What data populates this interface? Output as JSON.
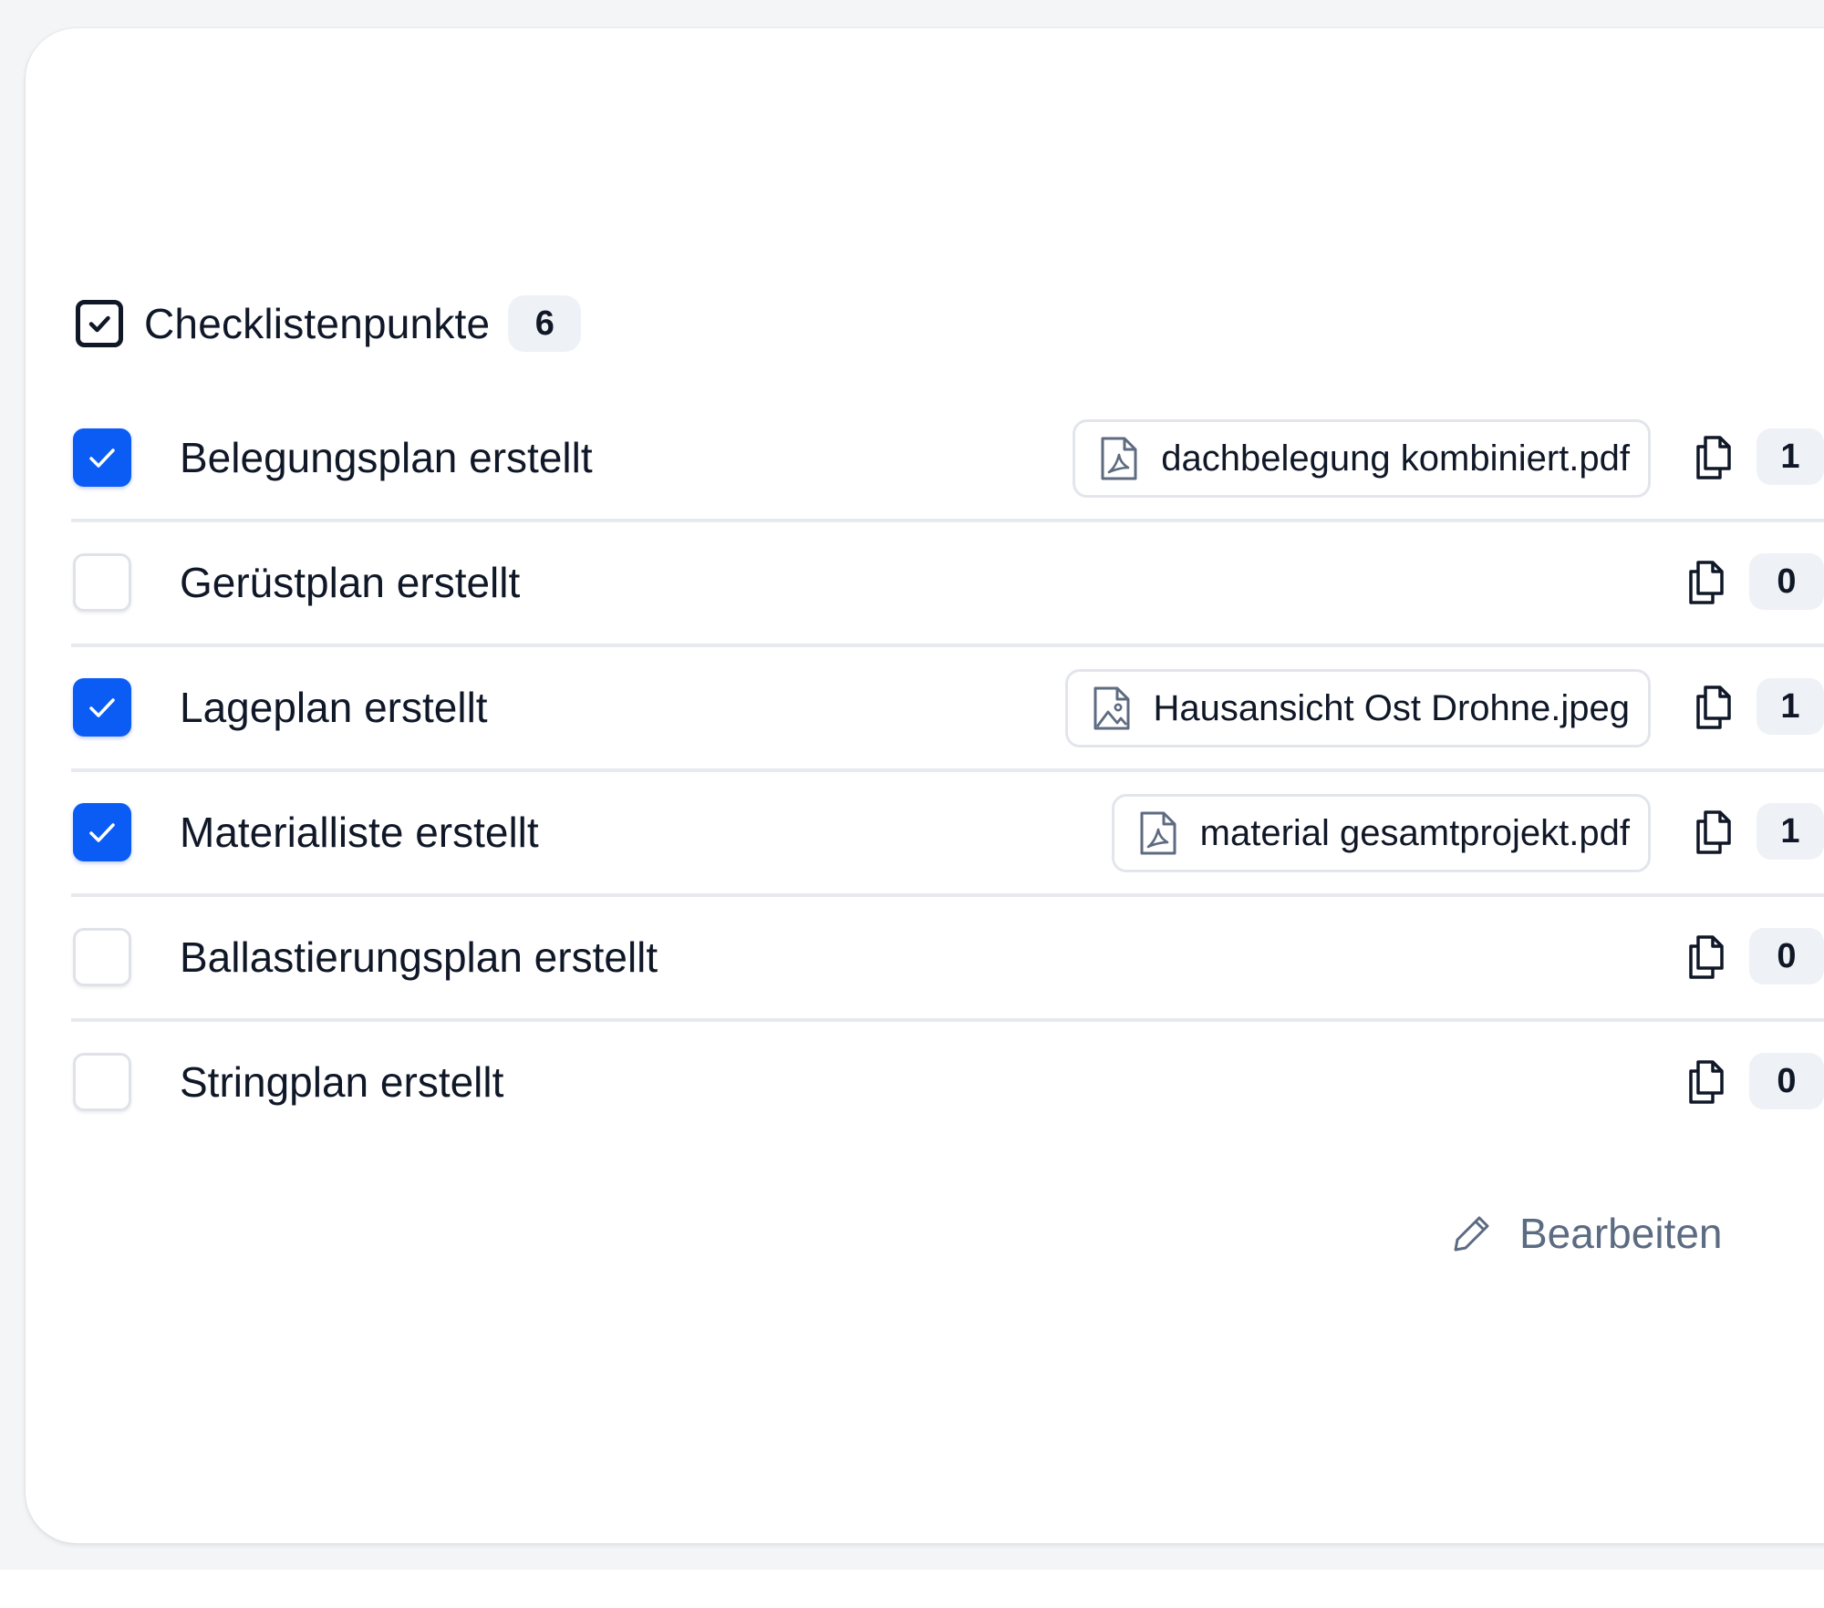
{
  "section": {
    "title": "Checklistenpunkte",
    "count": "6",
    "icon": "checkbox-square-icon"
  },
  "items": [
    {
      "label": "Belegungsplan erstellt",
      "checked": true,
      "attachment": "dachbelegung kombiniert.pdf",
      "attachment_icon": "pdf-file-icon",
      "file_count": "1"
    },
    {
      "label": "Gerüstplan erstellt",
      "checked": false,
      "attachment": "",
      "attachment_icon": "",
      "file_count": "0"
    },
    {
      "label": "Lageplan erstellt",
      "checked": true,
      "attachment": "Hausansicht Ost Drohne.jpeg",
      "attachment_icon": "image-file-icon",
      "file_count": "1"
    },
    {
      "label": "Materialliste erstellt",
      "checked": true,
      "attachment": "material gesamtprojekt.pdf",
      "attachment_icon": "pdf-file-icon",
      "file_count": "1"
    },
    {
      "label": "Ballastierungsplan erstellt",
      "checked": false,
      "attachment": "",
      "attachment_icon": "",
      "file_count": "0"
    },
    {
      "label": "Stringplan erstellt",
      "checked": false,
      "attachment": "",
      "attachment_icon": "",
      "file_count": "0"
    }
  ],
  "actions": {
    "edit_label": "Bearbeiten",
    "edit_icon": "pencil-icon"
  },
  "colors": {
    "accent": "#0a5cf5",
    "text": "#101828",
    "muted": "#5b6b82",
    "badge_bg": "#eef1f5",
    "divider": "#e6e9ee",
    "icon_gray": "#5e6b80"
  }
}
